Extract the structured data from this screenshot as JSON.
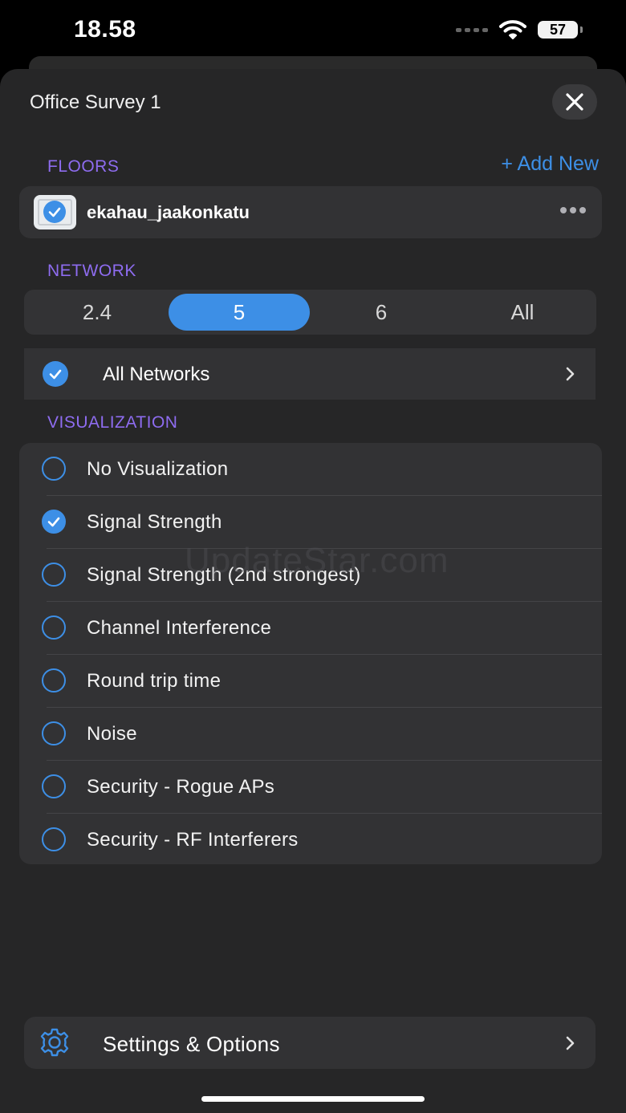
{
  "status_bar": {
    "time": "18.58",
    "battery": "57"
  },
  "sheet": {
    "title": "Office Survey 1"
  },
  "floors": {
    "section_label": "FLOORS",
    "add_new_label": "+ Add New",
    "items": [
      {
        "name": "ekahau_jaakonkatu",
        "selected": true
      }
    ]
  },
  "network": {
    "section_label": "NETWORK",
    "bands": [
      "2.4",
      "5",
      "6",
      "All"
    ],
    "selected_band": "5",
    "filter_label": "All Networks"
  },
  "visualization": {
    "section_label": "VISUALIZATION",
    "options": [
      {
        "label": "No Visualization",
        "selected": false
      },
      {
        "label": "Signal Strength",
        "selected": true
      },
      {
        "label": "Signal Strength (2nd strongest)",
        "selected": false
      },
      {
        "label": "Channel Interference",
        "selected": false
      },
      {
        "label": "Round trip time",
        "selected": false
      },
      {
        "label": "Noise",
        "selected": false
      },
      {
        "label": "Security - Rogue APs",
        "selected": false
      },
      {
        "label": "Security - RF Interferers",
        "selected": false
      }
    ]
  },
  "watermark": "UpdateStar.com",
  "settings": {
    "label": "Settings & Options"
  },
  "colors": {
    "accent": "#3d8fe6",
    "section": "#8e6cf0",
    "sheet_bg": "#262627",
    "row_bg": "#323234"
  }
}
